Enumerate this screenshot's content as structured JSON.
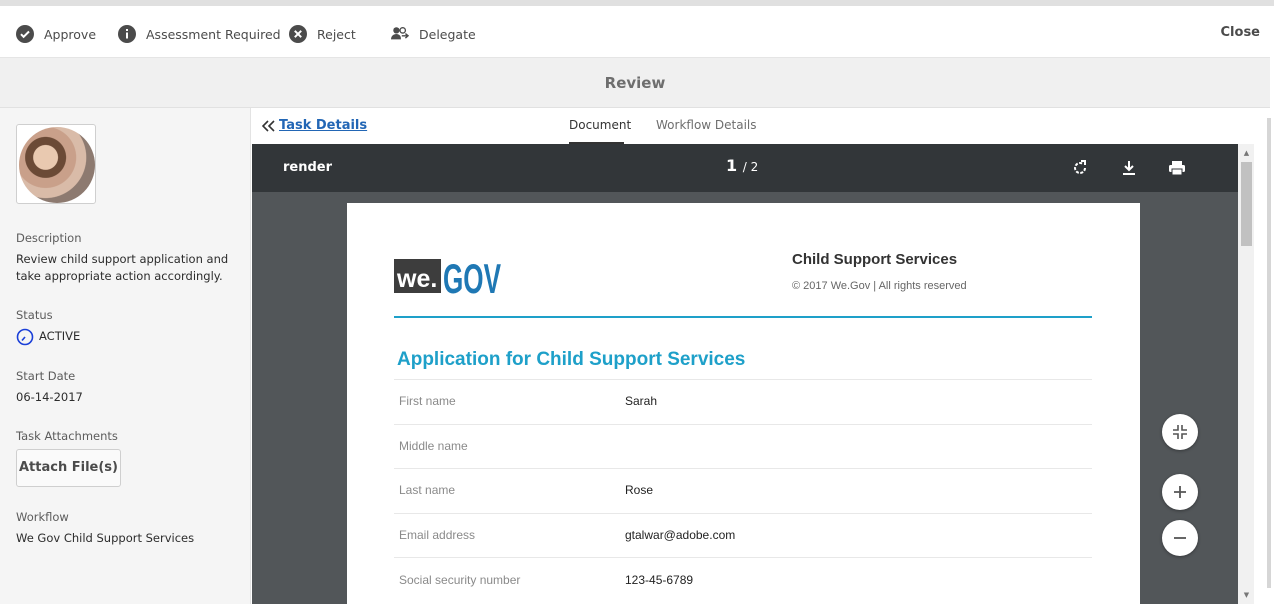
{
  "toolbar": {
    "approve": "Approve",
    "assessment": "Assessment Required",
    "reject": "Reject",
    "delegate": "Delegate",
    "close": "Close"
  },
  "header": {
    "title": "Review"
  },
  "sidebar": {
    "description_label": "Description",
    "description_value": "Review child support application and take appropriate action accordingly.",
    "status_label": "Status",
    "status_value": "ACTIVE",
    "start_date_label": "Start Date",
    "start_date_value": "06-14-2017",
    "attachments_label": "Task Attachments",
    "attach_button": "Attach File(s)",
    "workflow_label": "Workflow",
    "workflow_value": "We Gov Child Support Services"
  },
  "tabs": {
    "back_link": "Task Details",
    "items": [
      "Document",
      "Workflow Details"
    ],
    "active": "Document"
  },
  "viewer": {
    "title": "render",
    "current_page": "1",
    "total_pages": "/ 2",
    "icons": [
      "rotate-icon",
      "download-icon",
      "print-icon"
    ]
  },
  "document": {
    "logo_we": "we.",
    "logo_gov": "GOV",
    "org_title": "Child Support Services",
    "copyright": "© 2017 We.Gov | All rights reserved",
    "form_title": "Application for Child Support Services",
    "fields": [
      {
        "label": "First name",
        "value": "Sarah"
      },
      {
        "label": "Middle name",
        "value": ""
      },
      {
        "label": "Last name",
        "value": "Rose"
      },
      {
        "label": "Email address",
        "value": "gtalwar@adobe.com"
      },
      {
        "label": "Social security number",
        "value": "123-45-6789"
      }
    ]
  },
  "colors": {
    "accent": "#1ea0c9",
    "viewer_bar": "#323639",
    "viewer_bg": "#525659",
    "link": "#2266b5"
  }
}
